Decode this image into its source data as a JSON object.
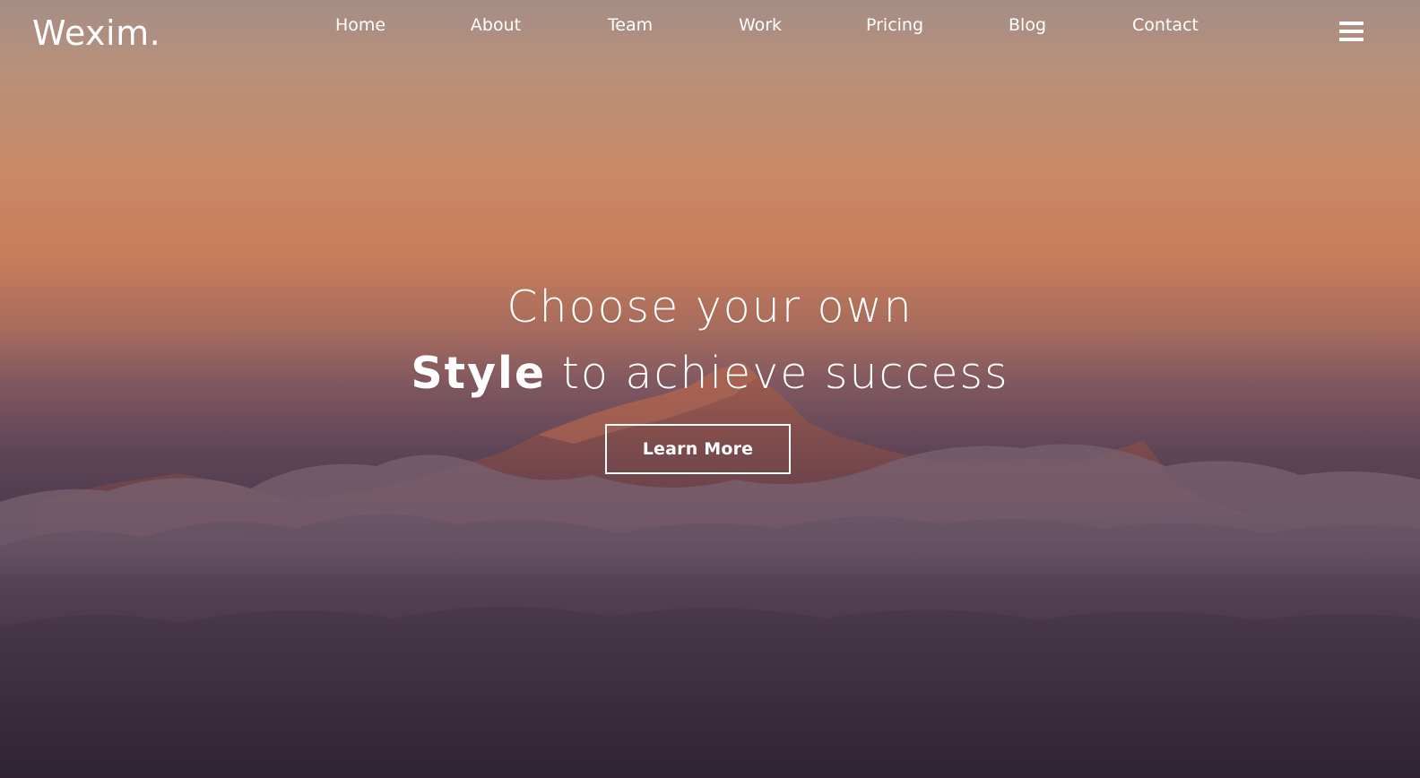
{
  "brand": {
    "logo_text": "Wexim."
  },
  "nav": {
    "items": [
      {
        "label": "Home"
      },
      {
        "label": "About"
      },
      {
        "label": "Team"
      },
      {
        "label": "Work"
      },
      {
        "label": "Pricing"
      },
      {
        "label": "Blog"
      },
      {
        "label": "Contact"
      }
    ],
    "menu_icon": "hamburger-icon"
  },
  "hero": {
    "line1": "Choose your own",
    "line2_bold": "Style",
    "line2_rest": " to achieve success",
    "cta_label": "Learn More"
  },
  "colors": {
    "text": "#ffffff",
    "sky_top": "#a58d86",
    "sky_glow": "#c98a66",
    "clouds_bottom": "#2e2434"
  }
}
